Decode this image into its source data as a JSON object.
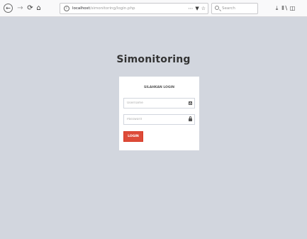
{
  "browser": {
    "url_host": "localhost",
    "url_path": "/simonitoring/login.php",
    "page_actions": "⋯",
    "search_placeholder": "Search",
    "icons": {
      "back": "←",
      "forward": "→",
      "reload": "⟳",
      "home": "⌂",
      "info": "i",
      "pocket": "▼",
      "bookmark": "☆",
      "download": "⤓",
      "library": "Ⅱ∖",
      "sidebar": "◫"
    }
  },
  "page": {
    "title": "Simonitoring",
    "heading": "SILAHKAN LOGIN",
    "username_placeholder": "Username",
    "password_placeholder": "Password",
    "login_label": "LOGIN"
  },
  "colors": {
    "background": "#d2d6de",
    "login_button": "#dd4b39"
  }
}
